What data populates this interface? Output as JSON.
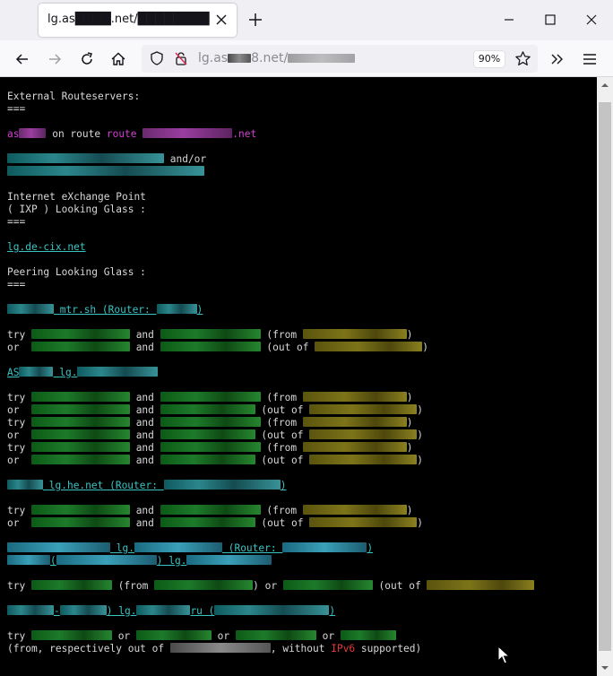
{
  "browser": {
    "tab_title": "lg.as████.net/████████",
    "url_prefix": "lg.as",
    "url_mid": "8.net/",
    "zoom": "90%"
  },
  "page": {
    "external_heading": "External Routeservers:",
    "sep": "===",
    "as_prefix": "as",
    "on_route": " on route ",
    "net_suffix": ".net",
    "andor": " and/or",
    "ixp_heading_1": "Internet eXchange Point",
    "ixp_heading_2": "( IXP ) Looking Glass :",
    "decix_link": "lg.de-cix.net",
    "peering_heading": "Peering Looking Glass :",
    "mtr_link": "mtr.sh (Router: ",
    "close_paren": ")",
    "try": "try ",
    "or": "or  ",
    "and": " and ",
    "from": " (from ",
    "outof": " (out of ",
    "as_link_prefix": "AS",
    "lg_prefix": "lg.",
    "he_link": "lg.he.net (Router: ",
    "router_label": "(Router: ",
    "or_mid": " or ",
    "ru_suffix": "ru (",
    "dash_open": "(-",
    "paren_lg": ") lg.",
    "final_1": "(from, respectively out of ",
    "final_2": ", without ",
    "ipv6": "IPv6",
    "final_3": " supported)"
  },
  "colors": {
    "background": "#000000",
    "text": "#d8d8d8",
    "magenta": "#d23fd2",
    "cyan": "#39c4c4",
    "red": "#e33a3a"
  },
  "icons": [
    "close-icon",
    "plus-icon",
    "minimize-icon",
    "maximize-icon",
    "back-icon",
    "forward-icon",
    "reload-icon",
    "home-icon",
    "shield-icon",
    "lock-icon",
    "star-icon",
    "overflow-icon",
    "menu-icon"
  ]
}
